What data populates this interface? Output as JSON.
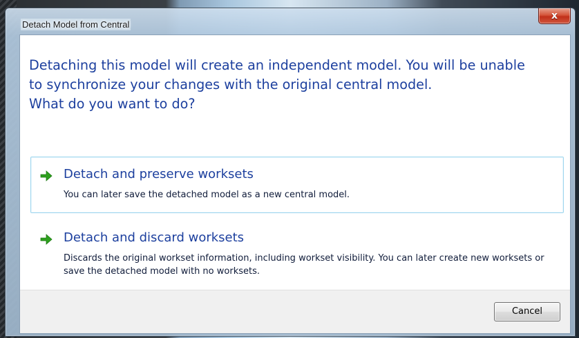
{
  "window": {
    "title": "Detach Model from Central",
    "close_label": "x"
  },
  "main": {
    "instruction_lines": [
      "Detaching this model will create an independent model. You will be unable",
      "to synchronize your changes with the original central model.",
      "What do you want to do?"
    ],
    "options": [
      {
        "title": "Detach and preserve worksets",
        "description": "You can later save the detached model as a new central model.",
        "icon": "green-arrow-icon"
      },
      {
        "title": "Detach and discard worksets",
        "description": "Discards the original workset information, including workset visibility. You can later create new worksets or save the detached model with no worksets.",
        "icon": "green-arrow-icon"
      }
    ]
  },
  "footer": {
    "cancel_label": "Cancel"
  },
  "colors": {
    "accent_text": "#1c3f9e",
    "arrow_green": "#2ea01e",
    "selection_border": "#9ed6ee",
    "close_red": "#c1301a"
  }
}
